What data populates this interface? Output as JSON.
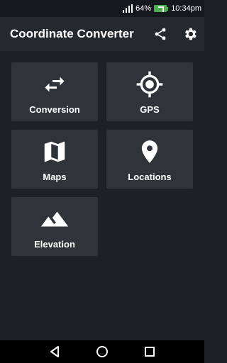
{
  "status_bar": {
    "battery": "64%",
    "time": "10:34pm"
  },
  "app_bar": {
    "title": "Coordinate Converter",
    "actions": [
      {
        "icon": "share-icon"
      },
      {
        "icon": "gear-icon"
      }
    ]
  },
  "tiles": [
    {
      "label": "Conversion",
      "icon": "swap-arrows-icon"
    },
    {
      "label": "GPS",
      "icon": "gps-crosshair-icon"
    },
    {
      "label": "Maps",
      "icon": "map-icon"
    },
    {
      "label": "Locations",
      "icon": "location-pin-icon"
    },
    {
      "label": "Elevation",
      "icon": "mountain-icon"
    }
  ],
  "nav_bar": {
    "buttons": [
      {
        "icon": "back-triangle-icon"
      },
      {
        "icon": "home-circle-icon"
      },
      {
        "icon": "recents-square-icon"
      }
    ]
  },
  "colors": {
    "background": "#1d2126",
    "app_bar": "#24292e",
    "tile": "#2e3439",
    "battery": "#4caf50"
  }
}
